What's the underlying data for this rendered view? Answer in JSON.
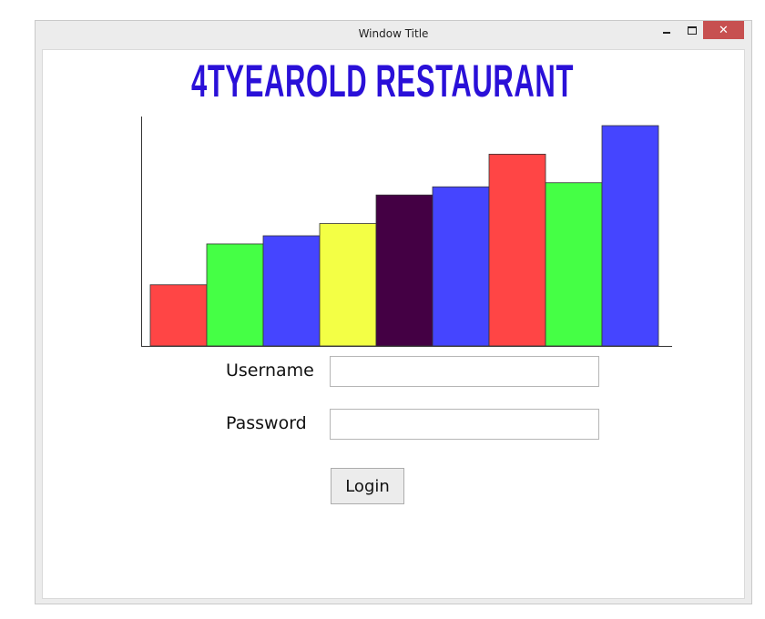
{
  "window": {
    "title": "Window Title",
    "minimize_glyph": "–",
    "close_glyph": "✕"
  },
  "app": {
    "title": "4TYEAROLD RESTAURANT",
    "title_color": "#2a10d8"
  },
  "chart_data": {
    "type": "bar",
    "values": [
      15,
      25,
      27,
      30,
      37,
      39,
      47,
      40,
      54
    ],
    "colors": [
      "#ff4545",
      "#45ff45",
      "#4545ff",
      "#f3ff45",
      "#440044",
      "#4545ff",
      "#ff4545",
      "#45ff45",
      "#4545ff"
    ],
    "ylim": [
      0,
      54
    ],
    "grid": false
  },
  "form": {
    "username_label": "Username",
    "password_label": "Password",
    "username_value": "",
    "password_value": "",
    "login_label": "Login"
  }
}
